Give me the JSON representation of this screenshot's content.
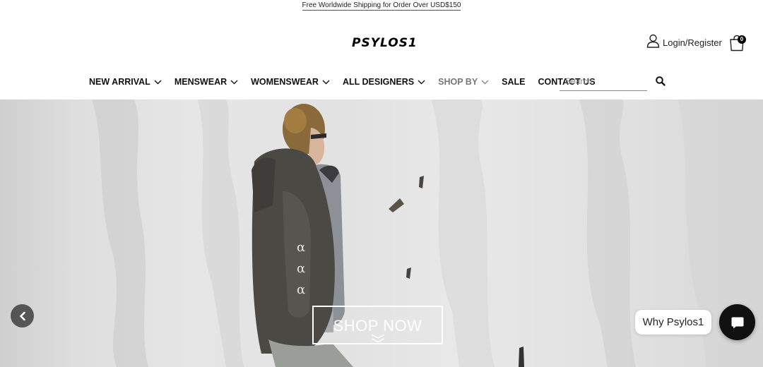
{
  "announcement": {
    "text": "Free Worldwide Shipping for Order Over USD$150"
  },
  "header": {
    "logo_text": "PSYLOS1",
    "login_label": "Login/Register",
    "cart_count": "0"
  },
  "nav": {
    "items": [
      {
        "label": "NEW ARRIVAL",
        "has_dropdown": true
      },
      {
        "label": "MENSWEAR",
        "has_dropdown": true
      },
      {
        "label": "WOMENSWEAR",
        "has_dropdown": true
      },
      {
        "label": "ALL DESIGNERS",
        "has_dropdown": true
      },
      {
        "label": "SHOP BY",
        "has_dropdown": true
      },
      {
        "label": "SALE",
        "has_dropdown": false
      },
      {
        "label": "CONTACT US",
        "has_dropdown": false
      }
    ]
  },
  "search": {
    "placeholder": "Search",
    "value": ""
  },
  "hero": {
    "cta_label": "SHOP NOW",
    "prev_icon": "chevron-left-icon"
  },
  "chat": {
    "bubble_label": "Why Psylos1",
    "icon": "chat-icon"
  },
  "colors": {
    "text": "#111111",
    "muted_nav": "#777777",
    "hero_bg": "#e2e2e2",
    "chat_button": "#111111"
  }
}
